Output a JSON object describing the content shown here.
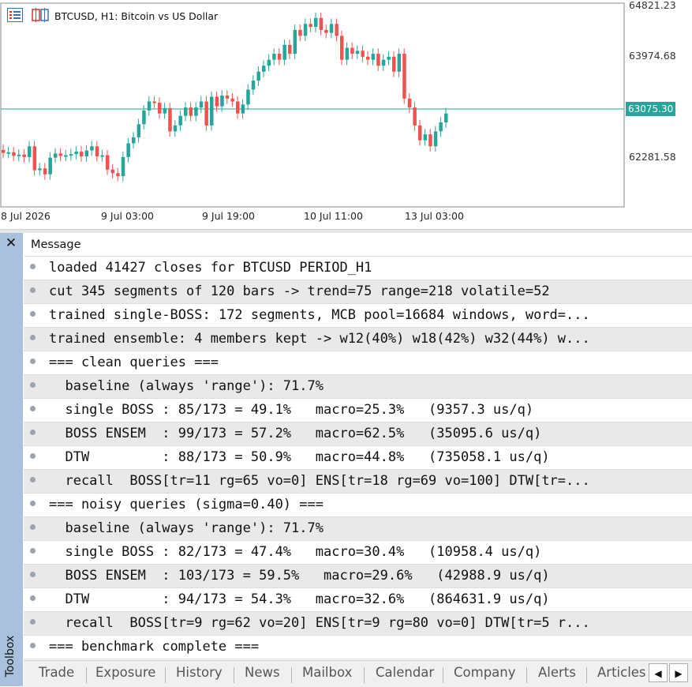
{
  "chart": {
    "title": "BTCUSD, H1:  Bitcoin vs US Dollar",
    "price_levels": [
      "64821.23",
      "63974.68",
      "62281.58"
    ],
    "current_price": "63075.30",
    "time_labels": [
      "8 Jul 2026",
      "9 Jul 03:00",
      "9 Jul 19:00",
      "10 Jul 11:00",
      "13 Jul 03:00"
    ],
    "colors": {
      "up": "#26a69a",
      "down": "#ef5350",
      "price_line": "#26a69a"
    }
  },
  "toolbox": {
    "label": "Toolbox",
    "close_symbol": "✕",
    "header": "Message",
    "messages": [
      "loaded 41427 closes for BTCUSD PERIOD_H1",
      "cut 345 segments of 120 bars -> trend=75 range=218 volatile=52",
      "trained single-BOSS: 172 segments, MCB pool=16684 windows, word=...",
      "trained ensemble: 4 members kept -> w12(40%) w18(42%) w32(44%) w...",
      "=== clean queries ===",
      "  baseline (always 'range'): 71.7%",
      "  single BOSS : 85/173 = 49.1%   macro=25.3%   (9357.3 us/q)",
      "  BOSS ENSEM  : 99/173 = 57.2%   macro=62.5%   (35095.6 us/q)",
      "  DTW         : 88/173 = 50.9%   macro=44.8%   (735058.1 us/q)",
      "  recall  BOSS[tr=11 rg=65 vo=0] ENS[tr=18 rg=69 vo=100] DTW[tr=...",
      "=== noisy queries (sigma=0.40) ===",
      "  baseline (always 'range'): 71.7%",
      "  single BOSS : 82/173 = 47.4%   macro=30.4%   (10958.4 us/q)",
      "  BOSS ENSEM  : 103/173 = 59.5%   macro=29.6%   (42988.9 us/q)",
      "  DTW         : 94/173 = 54.3%   macro=32.6%   (864631.9 us/q)",
      "  recall  BOSS[tr=9 rg=62 vo=20] ENS[tr=9 rg=80 vo=0] DTW[tr=5 r...",
      "=== benchmark complete ==="
    ],
    "tabs": [
      "Trade",
      "Exposure",
      "History",
      "News",
      "Mailbox",
      "Calendar",
      "Company",
      "Alerts",
      "Articles"
    ],
    "scroll_left": "◀",
    "scroll_right": "▶"
  }
}
